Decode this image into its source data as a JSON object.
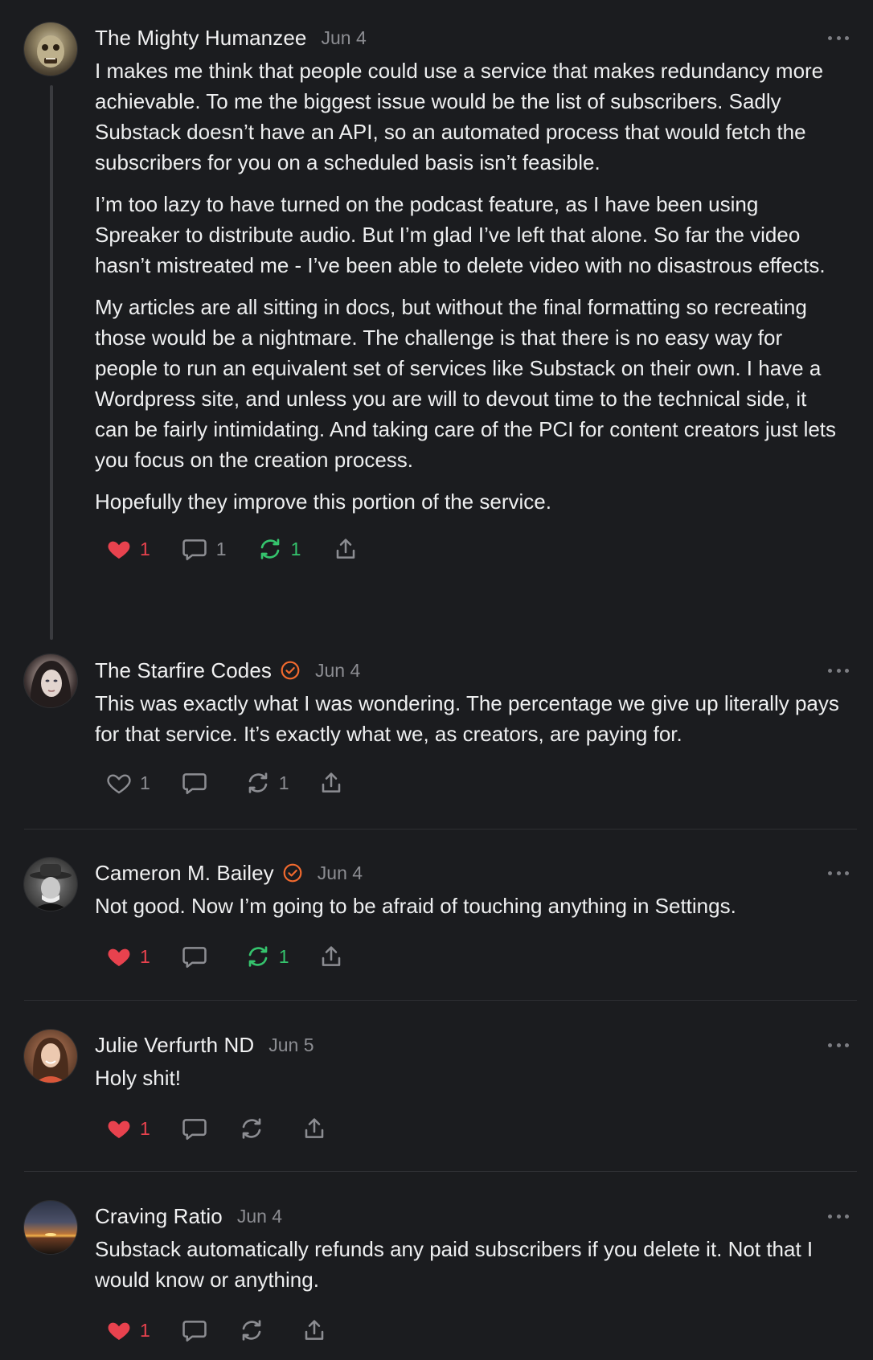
{
  "colors": {
    "background": "#1b1c1f",
    "like_active": "#e8424e",
    "restack_active": "#35c46d",
    "verified": "#f26a2e",
    "muted": "#8c8d92"
  },
  "comments": [
    {
      "author": "The Mighty Humanzee",
      "verified": false,
      "date": "Jun 4",
      "paragraphs": [
        "I makes me think that people could use a service that makes redundancy more achievable. To me the biggest issue would be the list of subscribers. Sadly Substack doesn’t have an API, so an automated process that would fetch the subscribers for you on a scheduled basis isn’t feasible.",
        "I’m too lazy to have turned on the podcast feature, as I have been using Spreaker to distribute audio. But I’m glad I’ve left that alone. So far the video hasn’t mistreated me - I’ve been able to delete video with no disastrous effects.",
        "My articles are all sitting in docs, but without the final formatting so recreating those would be a nightmare. The challenge is that there is no easy way for people to run an equivalent set of services like Substack on their own. I have a Wordpress site, and unless you are will to devout time to the technical side, it can be fairly intimidating. And taking care of the PCI for content creators just lets you focus on the creation process.",
        "Hopefully they improve this portion of the service."
      ],
      "likes": "1",
      "liked": true,
      "replies": "1",
      "restacks": "1",
      "restacked": true
    },
    {
      "author": "The Starfire Codes",
      "verified": true,
      "date": "Jun 4",
      "paragraphs": [
        "This was exactly what I was wondering. The percentage we give up literally pays for that service. It’s exactly what we, as creators, are paying for."
      ],
      "likes": "1",
      "liked": false,
      "replies": "",
      "restacks": "1",
      "restacked": false
    },
    {
      "author": "Cameron M. Bailey",
      "verified": true,
      "date": "Jun 4",
      "paragraphs": [
        "Not good. Now I’m going to be afraid of touching anything in Settings."
      ],
      "likes": "1",
      "liked": true,
      "replies": "",
      "restacks": "1",
      "restacked": true
    },
    {
      "author": "Julie Verfurth ND",
      "verified": false,
      "date": "Jun 5",
      "paragraphs": [
        "Holy shit!"
      ],
      "likes": "1",
      "liked": true,
      "replies": "",
      "restacks": "",
      "restacked": false
    },
    {
      "author": "Craving Ratio",
      "verified": false,
      "date": "Jun 4",
      "paragraphs": [
        "Substack automatically refunds any paid subscribers if you delete it. Not that I would know or anything."
      ],
      "likes": "1",
      "liked": true,
      "replies": "",
      "restacks": "",
      "restacked": false
    }
  ]
}
